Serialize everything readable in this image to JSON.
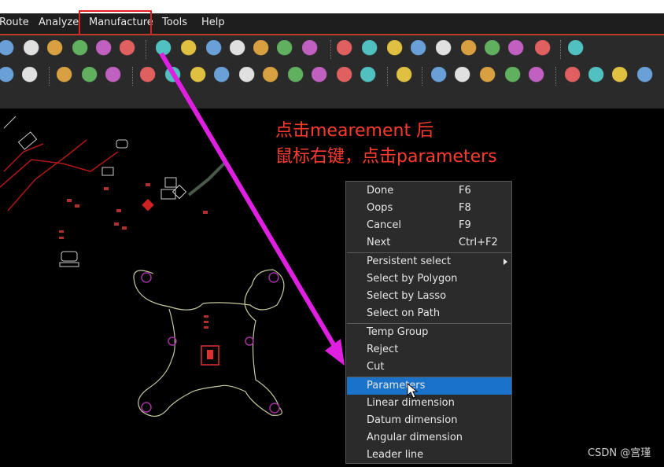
{
  "menubar": {
    "items": [
      "Route",
      "Analyze",
      "Manufacture",
      "Tools",
      "Help"
    ],
    "highlighted": "Manufacture"
  },
  "annotation": {
    "line1": "点击mearement 后",
    "line2": "鼠标右键，点击parameters",
    "color": "#ff3b30"
  },
  "context_menu": {
    "groups": [
      [
        {
          "label": "Done",
          "shortcut": "F6"
        },
        {
          "label": "Oops",
          "shortcut": "F8"
        },
        {
          "label": "Cancel",
          "shortcut": "F9"
        },
        {
          "label": "Next",
          "shortcut": "Ctrl+F2"
        }
      ],
      [
        {
          "label": "Persistent select",
          "shortcut": "",
          "submenu": true
        },
        {
          "label": "Select by Polygon",
          "shortcut": ""
        },
        {
          "label": "Select by Lasso",
          "shortcut": ""
        },
        {
          "label": "Select on Path",
          "shortcut": ""
        }
      ],
      [
        {
          "label": "Temp Group",
          "shortcut": ""
        },
        {
          "label": "Reject",
          "shortcut": ""
        },
        {
          "label": "Cut",
          "shortcut": ""
        }
      ],
      [
        {
          "label": "Parameters",
          "shortcut": "",
          "selected": true
        },
        {
          "label": "Linear dimension",
          "shortcut": ""
        },
        {
          "label": "Datum dimension",
          "shortcut": ""
        },
        {
          "label": "Angular dimension",
          "shortcut": ""
        },
        {
          "label": "Leader line",
          "shortcut": ""
        }
      ]
    ]
  },
  "watermark": "CSDN @宫瑾",
  "colors": {
    "menubar": "#1e1e1e",
    "toolbar": "#2a2a2a",
    "menu_highlight_box": "#e02020",
    "selected_item": "#1a73c8",
    "arrow": "#e020e0",
    "board_outline": "#c8c8a0"
  },
  "toolbar_icons": {
    "row1": [
      "zoom-out-icon",
      "zoom-prev-icon",
      "zoom-in-icon",
      "refresh-icon",
      "board-icon",
      "flip-icon",
      "grid-icon",
      "color-wheel-icon",
      "layers-icon",
      "stack-icon",
      "report-icon",
      "report-chart-icon",
      "gear-doc-icon",
      "eye-icon",
      "info-icon",
      "ruler-icon",
      "pen-icon",
      "sun-icon",
      "sun-off-icon",
      "target-icon",
      "hourglass-icon",
      "pointer-icon",
      "share-icon"
    ],
    "row2": [
      "line-icon",
      "pcb-icon",
      "zoom-select-icon",
      "datum-icon",
      "dimension-icon",
      "doc-1-icon",
      "doc-2-icon",
      "doc-3-icon",
      "camera-icon",
      "r2-icon",
      "doc-4-icon",
      "square-icon",
      "tp-icon",
      "dots-icon",
      "dots-2-icon",
      "node-icon",
      "drc-1-icon",
      "drc-2-icon",
      "drc-3-icon",
      "drc-4-icon",
      "warning-icon",
      "chart-icon",
      "cycle-icon",
      "bow-icon",
      "help-icon"
    ]
  }
}
